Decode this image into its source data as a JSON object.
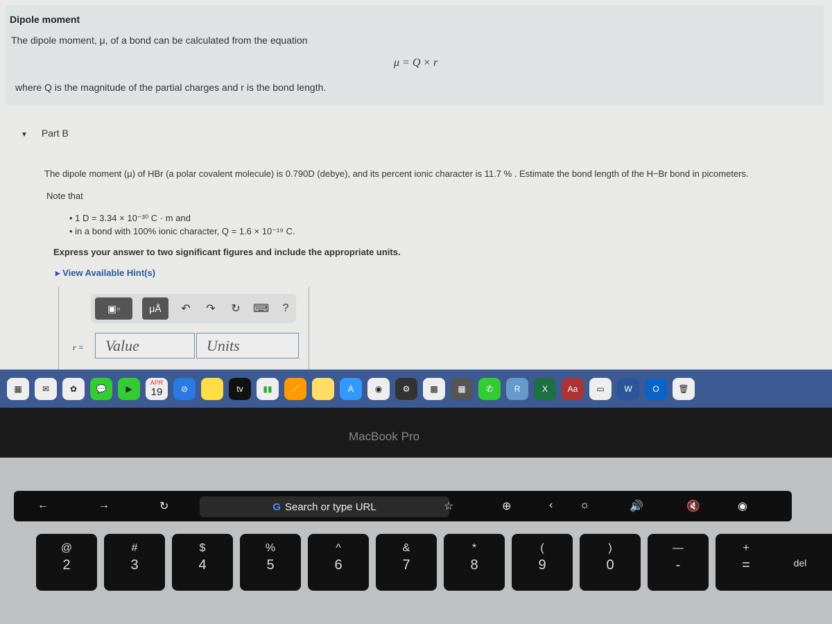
{
  "intro": {
    "title": "Dipole moment",
    "line1": "The dipole moment, μ, of a bond can be calculated from the equation",
    "equation": "μ = Q × r",
    "line2": "where Q is the magnitude of the partial charges and r is the bond length."
  },
  "part": {
    "label": "Part B"
  },
  "question": "The dipole moment (μ) of HBr (a polar covalent molecule) is 0.790D (debye), and its percent ionic character is 11.7 % . Estimate the bond length of the H−Br bond in picometers.",
  "note": "Note that",
  "bullets": [
    "1 D = 3.34 × 10⁻³⁰ C · m and",
    "in a bond with 100% ionic character, Q = 1.6 × 10⁻¹⁹ C."
  ],
  "express": "Express your answer to two significant figures and include the appropriate units.",
  "hint": "View Available Hint(s)",
  "answer": {
    "label": "r =",
    "value_placeholder": "Value",
    "units_placeholder": "Units",
    "units_btn": "μÅ",
    "help": "?"
  },
  "dock": {
    "calendar_month": "APR",
    "calendar_day": "19",
    "tv": "tv",
    "dictionary": "Aa"
  },
  "bezel": "MacBook Pro",
  "touchbar": {
    "url": "Search or type URL"
  },
  "keys": [
    {
      "u": "@",
      "d": "2"
    },
    {
      "u": "#",
      "d": "3"
    },
    {
      "u": "$",
      "d": "4"
    },
    {
      "u": "%",
      "d": "5"
    },
    {
      "u": "^",
      "d": "6"
    },
    {
      "u": "&",
      "d": "7"
    },
    {
      "u": "*",
      "d": "8"
    },
    {
      "u": "(",
      "d": "9"
    },
    {
      "u": ")",
      "d": "0"
    },
    {
      "u": "—",
      "d": "-"
    },
    {
      "u": "+",
      "d": "="
    }
  ],
  "del": "del"
}
